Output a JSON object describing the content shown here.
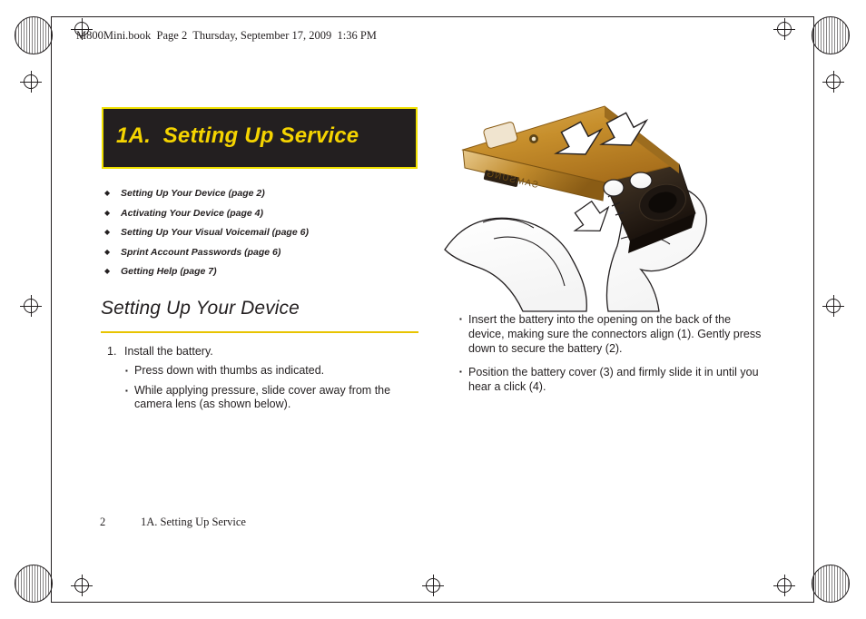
{
  "header": {
    "bookline": "M800Mini.book  Page 2  Thursday, September 17, 2009  1:36 PM"
  },
  "chapter": {
    "number": "1A.",
    "title": "1A.  Setting Up Service"
  },
  "toc": {
    "bullet": "◆",
    "items": [
      {
        "label": "Setting Up Your Device (page 2)"
      },
      {
        "label": "Activating Your Device (page 4)"
      },
      {
        "label": "Setting Up Your Visual Voicemail (page 6)"
      },
      {
        "label": "Sprint Account Passwords (page 6)"
      },
      {
        "label": "Getting Help (page 7)"
      }
    ]
  },
  "section": {
    "heading": "Setting Up Your Device"
  },
  "steps": {
    "bullet": "▪",
    "items": [
      {
        "number": "1.",
        "text": "Install the battery.",
        "subitems": [
          "Press down with thumbs as indicated.",
          "While applying pressure, slide cover away from the camera lens (as shown below)."
        ]
      }
    ]
  },
  "right_column": {
    "bullet": "▪",
    "items": [
      "Insert the battery into the opening on the back of the device, making sure the connectors align (1). Gently press down to secure the battery (2).",
      "Position the battery cover (3) and firmly slide it in until you hear a click (4)."
    ]
  },
  "footer": {
    "page_number": "2",
    "chapter_label": "1A. Setting Up Service"
  },
  "illustration": {
    "device_brand": "SAMSUNG",
    "alt": "Hands holding a gold Samsung phone, arrows indicating pressing down and sliding the battery cover"
  },
  "colors": {
    "chapter_box_bg": "#231f20",
    "chapter_box_border": "#f0e000",
    "chapter_title": "#f5d400",
    "rule": "#e8c400",
    "text": "#231f20",
    "device_gold": "#c98f2e",
    "device_dark": "#2b2118"
  }
}
